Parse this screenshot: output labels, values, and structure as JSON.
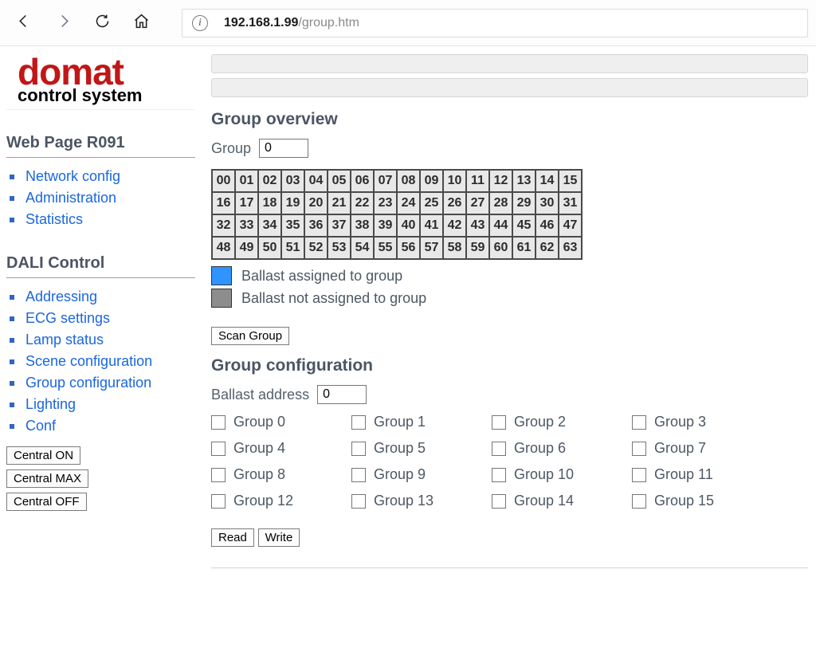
{
  "browser": {
    "url_host": "192.168.1.99",
    "url_path": "/group.htm"
  },
  "logo": {
    "top": "domat",
    "bottom": "control system"
  },
  "sidebar": {
    "page_title": "Web Page R091",
    "section1_title": "",
    "nav1": [
      "Network config",
      "Administration",
      "Statistics"
    ],
    "section2_title": "DALI Control",
    "nav2": [
      "Addressing",
      "ECG settings",
      "Lamp status",
      "Scene configuration",
      "Group configuration",
      "Lighting",
      "Conf"
    ],
    "btn_on": "Central ON",
    "btn_max": "Central MAX",
    "btn_off": "Central OFF"
  },
  "main": {
    "overview_title": "Group overview",
    "group_label": "Group",
    "group_value": "0",
    "cells": [
      "00",
      "01",
      "02",
      "03",
      "04",
      "05",
      "06",
      "07",
      "08",
      "09",
      "10",
      "11",
      "12",
      "13",
      "14",
      "15",
      "16",
      "17",
      "18",
      "19",
      "20",
      "21",
      "22",
      "23",
      "24",
      "25",
      "26",
      "27",
      "28",
      "29",
      "30",
      "31",
      "32",
      "33",
      "34",
      "35",
      "36",
      "37",
      "38",
      "39",
      "40",
      "41",
      "42",
      "43",
      "44",
      "45",
      "46",
      "47",
      "48",
      "49",
      "50",
      "51",
      "52",
      "53",
      "54",
      "55",
      "56",
      "57",
      "58",
      "59",
      "60",
      "61",
      "62",
      "63"
    ],
    "legend_assigned": "Ballast assigned to group",
    "legend_not_assigned": "Ballast not assigned to group",
    "scan_btn": "Scan Group",
    "config_title": "Group configuration",
    "ballast_label": "Ballast address",
    "ballast_value": "0",
    "groups": [
      "Group 0",
      "Group 1",
      "Group 2",
      "Group 3",
      "Group 4",
      "Group 5",
      "Group 6",
      "Group 7",
      "Group 8",
      "Group 9",
      "Group 10",
      "Group 11",
      "Group 12",
      "Group 13",
      "Group 14",
      "Group 15"
    ],
    "read_btn": "Read",
    "write_btn": "Write"
  }
}
